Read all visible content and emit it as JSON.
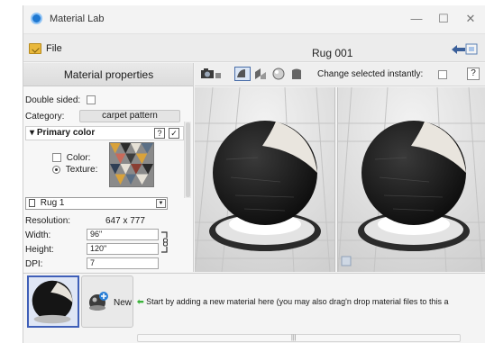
{
  "window": {
    "title": "Material Lab",
    "minimize_glyph": "—",
    "maximize_glyph": "☐",
    "close_glyph": "✕"
  },
  "menubar": {
    "file_label": "File",
    "document_title": "Rug 001"
  },
  "left_panel": {
    "header": "Material properties",
    "double_sided_label": "Double sided:",
    "double_sided_checked": false,
    "category_label": "Category:",
    "category_value": "carpet pattern",
    "primary_color": {
      "title": "Primary color",
      "help_glyph": "?",
      "check_glyph": "✓",
      "color_option": "Color:",
      "texture_option": "Texture:",
      "selected_option": "texture"
    },
    "texture_select": "Rug 1",
    "resolution_label": "Resolution:",
    "resolution_value": "647 x 777",
    "width_label": "Width:",
    "width_value": "96\"",
    "height_label": "Height:",
    "height_value": "120\"",
    "dpi_label": "DPI:",
    "dpi_value": "7"
  },
  "render_toolbar": {
    "change_instantly_label": "Change selected instantly:",
    "change_instantly_checked": false,
    "help_glyph": "?"
  },
  "bottom": {
    "new_label": "New",
    "hint": "Start by adding a new material here (you may also drag'n drop material files to this a",
    "scroll_grip": "|||"
  },
  "colors": {
    "accent": "#1f78d1",
    "selection_border": "#3f5fb8",
    "hint_arrow": "#3bb33b"
  },
  "icons": {
    "app": "material-lab-icon",
    "file": "folder-open-icon",
    "swap": "swap-arrows-icon",
    "new": "new-material-icon"
  }
}
